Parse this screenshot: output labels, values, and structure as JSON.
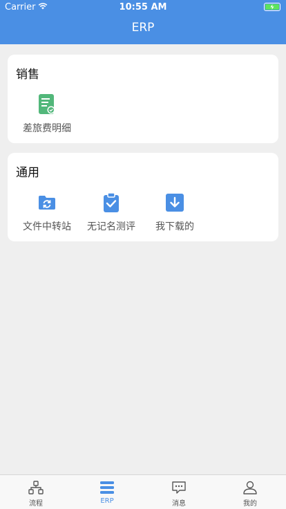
{
  "status_bar": {
    "carrier": "Carrier",
    "time": "10:55 AM"
  },
  "nav": {
    "title": "ERP"
  },
  "sections": [
    {
      "title": "销售",
      "items": [
        {
          "label": "差旅费明细",
          "icon": "document-check-icon",
          "color": "#52b77a"
        }
      ]
    },
    {
      "title": "通用",
      "items": [
        {
          "label": "文件中转站",
          "icon": "folder-sync-icon",
          "color": "#4a8fe4"
        },
        {
          "label": "无记名测评",
          "icon": "clipboard-check-icon",
          "color": "#4a8fe4"
        },
        {
          "label": "我下载的",
          "icon": "download-icon",
          "color": "#4a8fe4"
        }
      ]
    }
  ],
  "tabbar": {
    "items": [
      {
        "label": "流程",
        "icon": "flow-icon",
        "active": false
      },
      {
        "label": "ERP",
        "icon": "menu-icon",
        "active": true
      },
      {
        "label": "消息",
        "icon": "message-icon",
        "active": false
      },
      {
        "label": "我的",
        "icon": "user-icon",
        "active": false
      }
    ]
  },
  "colors": {
    "primary": "#4a8fe4",
    "background": "#efefef",
    "green": "#52b77a",
    "battery": "#5ee35e"
  }
}
